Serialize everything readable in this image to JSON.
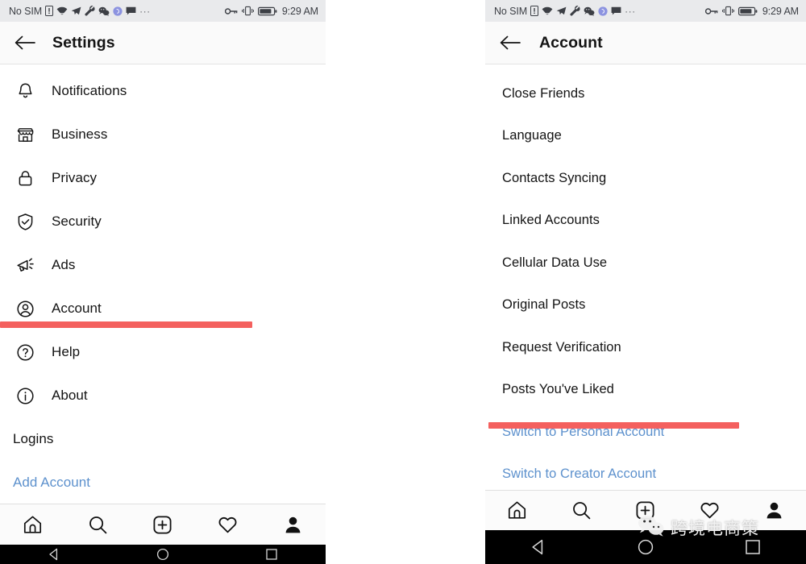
{
  "status_bar": {
    "carrier": "No SIM",
    "icons": [
      "sim-alert-icon",
      "wifi-icon",
      "telegram-icon",
      "wrench-icon",
      "wechat-icon",
      "app-circle-icon",
      "message-icon",
      "overflow-dots-icon"
    ],
    "overflow": "···",
    "right_icons": [
      "vpn-key-icon",
      "vibrate-icon",
      "battery-icon"
    ],
    "time": "9:29 AM"
  },
  "left_phone": {
    "header": {
      "back_icon": "back-arrow-icon",
      "title": "Settings"
    },
    "items": [
      {
        "label": "Notifications",
        "icon": "bell-icon",
        "style": "normal"
      },
      {
        "label": "Business",
        "icon": "store-icon",
        "style": "normal"
      },
      {
        "label": "Privacy",
        "icon": "lock-icon",
        "style": "normal"
      },
      {
        "label": "Security",
        "icon": "shield-check-icon",
        "style": "normal"
      },
      {
        "label": "Ads",
        "icon": "megaphone-icon",
        "style": "normal"
      },
      {
        "label": "Account",
        "icon": "account-circle-icon",
        "style": "normal"
      },
      {
        "label": "Help",
        "icon": "help-circle-icon",
        "style": "normal"
      },
      {
        "label": "About",
        "icon": "info-circle-icon",
        "style": "normal"
      },
      {
        "label": "Logins",
        "icon": "none",
        "style": "section"
      },
      {
        "label": "Add Account",
        "icon": "none",
        "style": "link"
      }
    ],
    "tabbar": [
      "home-icon",
      "search-icon",
      "add-post-icon",
      "heart-icon",
      "profile-icon"
    ],
    "navbar": [
      "back-triangle-icon",
      "home-circle-icon",
      "recents-square-icon"
    ]
  },
  "right_phone": {
    "header": {
      "back_icon": "back-arrow-icon",
      "title": "Account"
    },
    "items": [
      {
        "label": "Close Friends",
        "style": "normal"
      },
      {
        "label": "Language",
        "style": "normal"
      },
      {
        "label": "Contacts Syncing",
        "style": "normal"
      },
      {
        "label": "Linked Accounts",
        "style": "normal"
      },
      {
        "label": "Cellular Data Use",
        "style": "normal"
      },
      {
        "label": "Original Posts",
        "style": "normal"
      },
      {
        "label": "Request Verification",
        "style": "normal"
      },
      {
        "label": "Posts You've Liked",
        "style": "normal"
      },
      {
        "label": "Switch to Personal Account",
        "style": "link"
      },
      {
        "label": "Switch to Creator Account",
        "style": "link"
      }
    ],
    "tabbar": [
      "home-icon",
      "search-icon",
      "add-post-icon",
      "heart-icon",
      "profile-icon"
    ],
    "navbar": [
      "back-triangle-icon",
      "home-circle-icon",
      "recents-square-icon"
    ]
  },
  "highlights": {
    "color": "#f4605e",
    "left_target": "Account",
    "right_target": "Switch to Personal Account"
  },
  "watermark": {
    "text": "跨境电商策",
    "logo": "wechat-icon"
  },
  "colors": {
    "link": "#5d91cd",
    "text": "#131313",
    "statusbar_bg": "#e9eaec",
    "appbar_bg": "#fafafa",
    "highlight": "#f4605e"
  }
}
